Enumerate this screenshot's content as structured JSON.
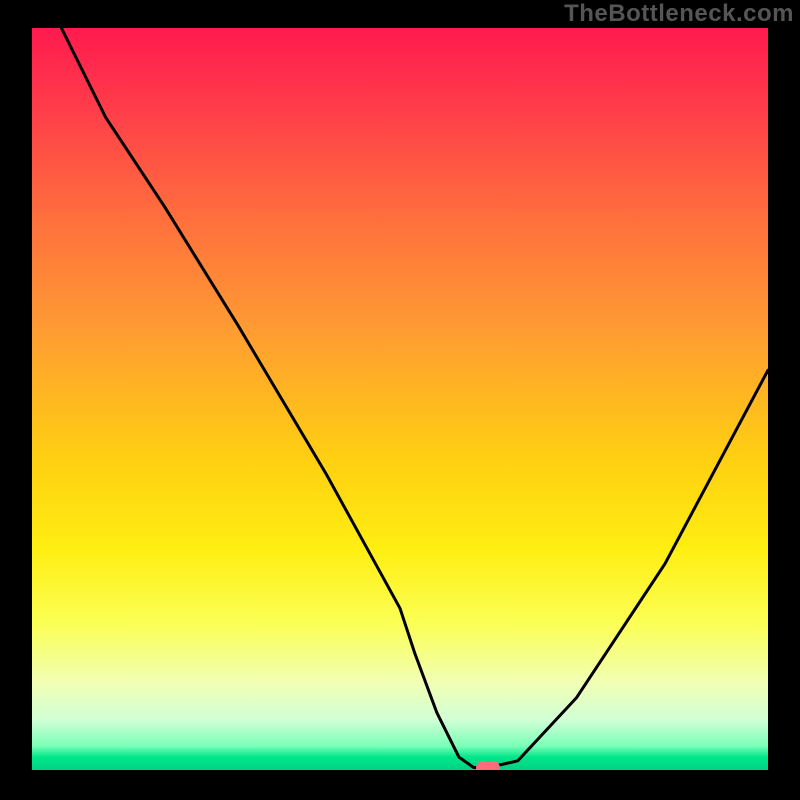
{
  "watermark": "TheBottleneck.com",
  "chart_data": {
    "type": "line",
    "title": "",
    "xlabel": "",
    "ylabel": "",
    "xlim": [
      0,
      100
    ],
    "ylim": [
      0,
      100
    ],
    "grid": false,
    "legend": false,
    "series": [
      {
        "name": "bottleneck-curve",
        "x": [
          4,
          10,
          18,
          28,
          40,
          50,
          52,
          55,
          58,
          60,
          62,
          66,
          74,
          86,
          100
        ],
        "values": [
          100,
          88,
          76,
          60,
          40,
          22,
          16,
          8,
          2,
          0.6,
          0.6,
          1.5,
          10,
          28,
          54
        ]
      }
    ],
    "marker": {
      "x": 62,
      "y": 0.6,
      "name": "optimal-point"
    },
    "background": {
      "type": "vertical-gradient",
      "stops": [
        {
          "pos": 0,
          "color": "#ff1a4f"
        },
        {
          "pos": 0.58,
          "color": "#ffd011"
        },
        {
          "pos": 0.98,
          "color": "#00e68a"
        }
      ]
    }
  }
}
